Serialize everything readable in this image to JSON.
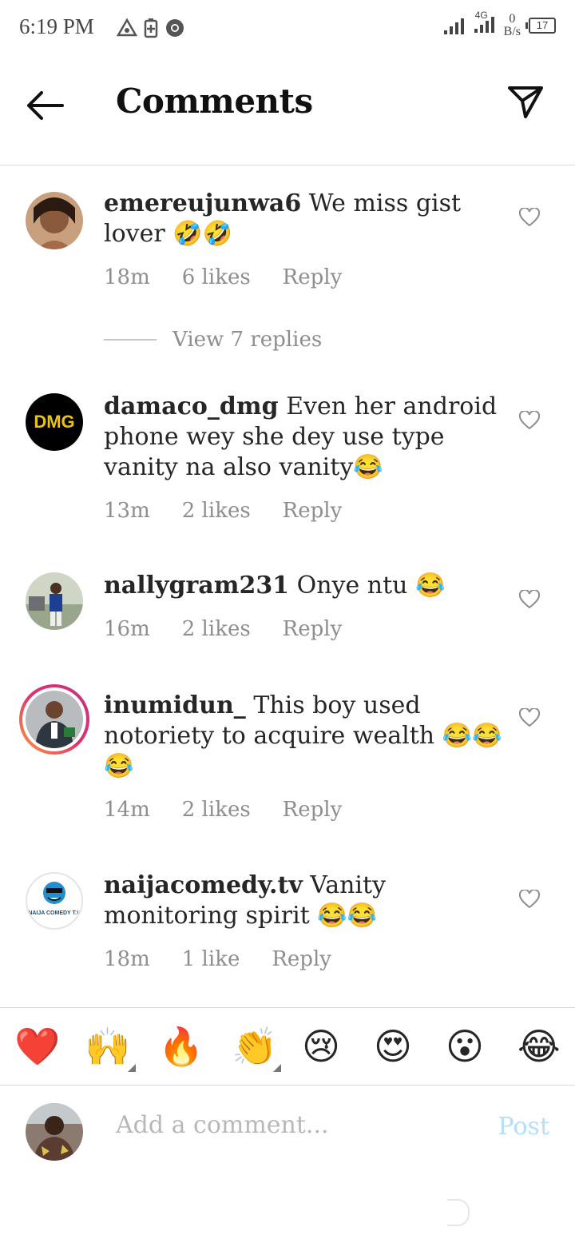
{
  "status_bar": {
    "time": "6:19 PM",
    "network_top": "4G",
    "speed_value": "0",
    "speed_unit": "B/s",
    "battery": "17"
  },
  "header": {
    "title": "Comments",
    "back_icon": "arrow-left-icon",
    "share_icon": "paper-plane-icon"
  },
  "comments": [
    {
      "username": "emereujunwa6",
      "text": "We miss gist lover 🤣🤣",
      "time": "18m",
      "likes": "6 likes",
      "reply": "Reply",
      "view_replies": "View 7 replies"
    },
    {
      "username": "damaco_dmg",
      "text": "Even her android phone wey she dey use type vanity na also vanity😂",
      "time": "13m",
      "likes": "2 likes",
      "reply": "Reply",
      "avatar_text": "DMG"
    },
    {
      "username": "nallygram231",
      "text": "Onye ntu 😂",
      "time": "16m",
      "likes": "2 likes",
      "reply": "Reply"
    },
    {
      "username": "inumidun_",
      "text": "This boy used notoriety to acquire wealth 😂😂😂",
      "time": "14m",
      "likes": "2 likes",
      "reply": "Reply"
    },
    {
      "username": "naijacomedy.tv",
      "text": "Vanity monitoring spirit 😂😂",
      "time": "18m",
      "likes": "1 like",
      "reply": "Reply",
      "avatar_text": "NAIJA COMEDY T.V"
    }
  ],
  "emoji_bar": [
    "❤️",
    "🙌",
    "🔥",
    "👏",
    "😢",
    "😍",
    "😮",
    "😂"
  ],
  "composer": {
    "placeholder": "Add a comment...",
    "post_label": "Post"
  },
  "colors": {
    "muted_text": "#8e8e8e",
    "post_disabled": "#b2dffc",
    "divider": "#dbdbdb",
    "heart_red": "#ed4956"
  }
}
